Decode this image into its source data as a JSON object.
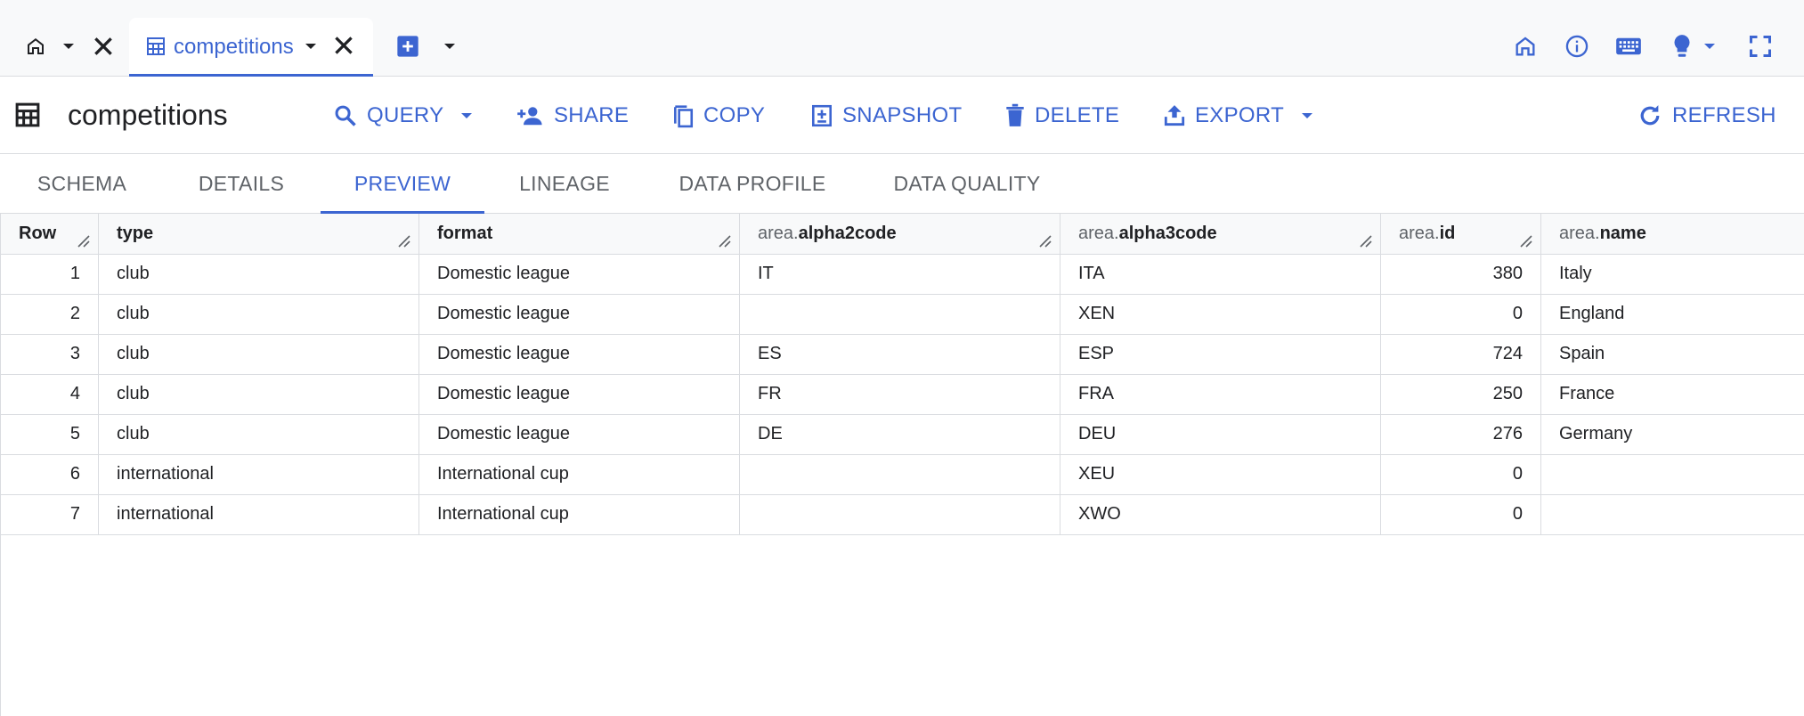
{
  "tabbar": {
    "active_tab_label": "competitions"
  },
  "toolbar": {
    "title": "competitions",
    "buttons": {
      "query": "QUERY",
      "share": "SHARE",
      "copy": "COPY",
      "snapshot": "SNAPSHOT",
      "delete": "DELETE",
      "export": "EXPORT",
      "refresh": "REFRESH"
    }
  },
  "subtabs": [
    "SCHEMA",
    "DETAILS",
    "PREVIEW",
    "LINEAGE",
    "DATA PROFILE",
    "DATA QUALITY"
  ],
  "active_subtab": "PREVIEW",
  "grid": {
    "headers": {
      "row": "Row",
      "type": "type",
      "format": "format",
      "prefix": "area.",
      "alpha2": "alpha2code",
      "alpha3": "alpha3code",
      "id": "id",
      "name": "name"
    },
    "rows": [
      {
        "row": "1",
        "type": "club",
        "format": "Domestic league",
        "alpha2": "IT",
        "alpha3": "ITA",
        "id": "380",
        "name": "Italy"
      },
      {
        "row": "2",
        "type": "club",
        "format": "Domestic league",
        "alpha2": "",
        "alpha3": "XEN",
        "id": "0",
        "name": "England"
      },
      {
        "row": "3",
        "type": "club",
        "format": "Domestic league",
        "alpha2": "ES",
        "alpha3": "ESP",
        "id": "724",
        "name": "Spain"
      },
      {
        "row": "4",
        "type": "club",
        "format": "Domestic league",
        "alpha2": "FR",
        "alpha3": "FRA",
        "id": "250",
        "name": "France"
      },
      {
        "row": "5",
        "type": "club",
        "format": "Domestic league",
        "alpha2": "DE",
        "alpha3": "DEU",
        "id": "276",
        "name": "Germany"
      },
      {
        "row": "6",
        "type": "international",
        "format": "International cup",
        "alpha2": "",
        "alpha3": "XEU",
        "id": "0",
        "name": ""
      },
      {
        "row": "7",
        "type": "international",
        "format": "International cup",
        "alpha2": "",
        "alpha3": "XWO",
        "id": "0",
        "name": ""
      }
    ]
  },
  "colors": {
    "accent": "#3c65d1",
    "icon_dark": "#202124",
    "muted": "#5f6368",
    "border": "#dadce0"
  }
}
